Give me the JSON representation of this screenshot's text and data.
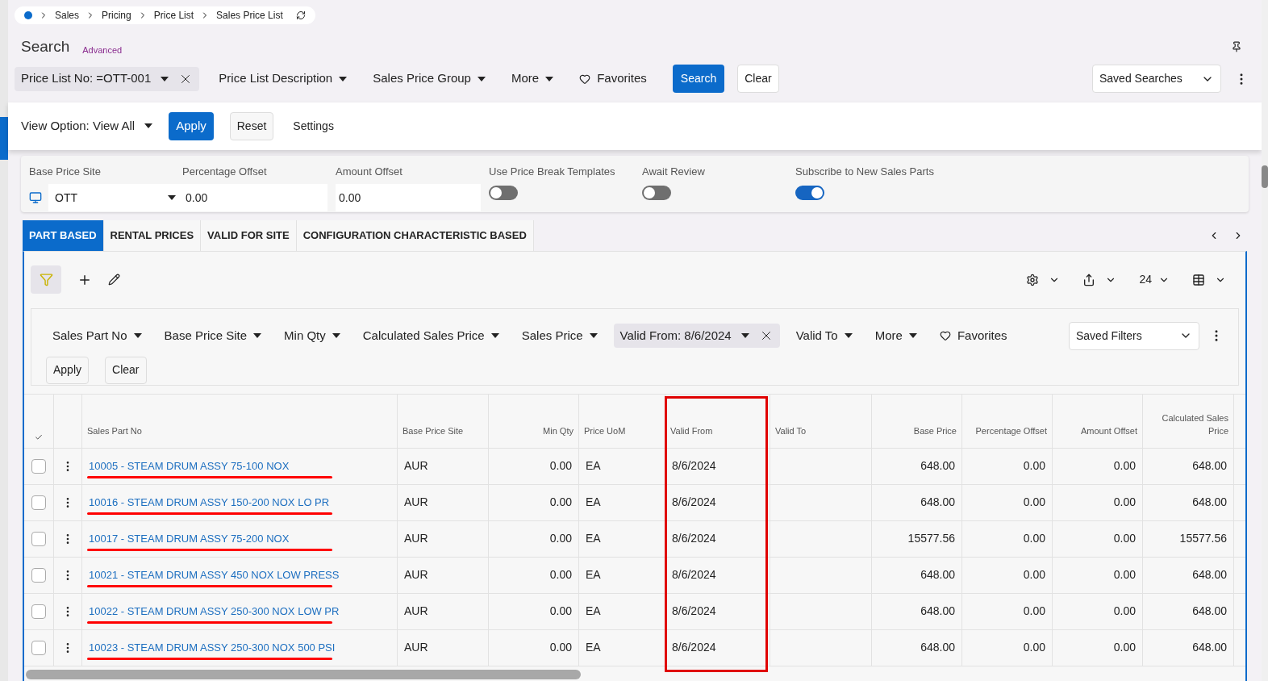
{
  "breadcrumb": [
    "Sales",
    "Pricing",
    "Price List",
    "Sales Price List"
  ],
  "search": {
    "title": "Search",
    "advanced": "Advanced",
    "filters": [
      {
        "label": "Price List No: =OTT-001",
        "kind": "active"
      },
      {
        "label": "Price List Description",
        "kind": "dropdown"
      },
      {
        "label": "Sales Price Group",
        "kind": "dropdown"
      },
      {
        "label": "More",
        "kind": "dropdown"
      },
      {
        "label": "Favorites",
        "kind": "favorites"
      }
    ],
    "search_button": "Search",
    "clear_button": "Clear",
    "saved_searches": "Saved Searches"
  },
  "view_bar": {
    "view_option": "View Option: View All",
    "apply": "Apply",
    "reset": "Reset",
    "settings": "Settings"
  },
  "header_fields": {
    "base_price_site": {
      "label": "Base Price Site",
      "value": "OTT"
    },
    "percentage_offset": {
      "label": "Percentage Offset",
      "value": "0.00"
    },
    "amount_offset": {
      "label": "Amount Offset",
      "value": "0.00"
    },
    "toggles": [
      {
        "label": "Use Price Break Templates",
        "on": false
      },
      {
        "label": "Await Review",
        "on": false
      },
      {
        "label": "Subscribe to New Sales Parts",
        "on": true
      }
    ]
  },
  "tabs": [
    {
      "label": "PART BASED",
      "selected": true
    },
    {
      "label": "RENTAL PRICES",
      "selected": false
    },
    {
      "label": "VALID FOR SITE",
      "selected": false
    },
    {
      "label": "CONFIGURATION CHARACTERISTIC BASED",
      "selected": false
    }
  ],
  "toolbar": {
    "page_size": "24"
  },
  "grid_filters": {
    "filters": [
      {
        "label": "Sales Part No",
        "kind": "dropdown"
      },
      {
        "label": "Base Price Site",
        "kind": "dropdown"
      },
      {
        "label": "Min Qty",
        "kind": "dropdown"
      },
      {
        "label": "Calculated Sales Price",
        "kind": "dropdown"
      },
      {
        "label": "Sales Price",
        "kind": "dropdown"
      },
      {
        "label": "Valid From: 8/6/2024",
        "kind": "active"
      },
      {
        "label": "Valid To",
        "kind": "dropdown"
      },
      {
        "label": "More",
        "kind": "dropdown"
      },
      {
        "label": "Favorites",
        "kind": "favorites"
      }
    ],
    "apply": "Apply",
    "clear": "Clear",
    "saved_filters": "Saved Filters"
  },
  "table": {
    "columns": [
      "Sales Part No",
      "Base Price Site",
      "Min Qty",
      "Price UoM",
      "Valid From",
      "Valid To",
      "Base Price",
      "Percentage Offset",
      "Amount Offset",
      "Calculated Sales Price"
    ],
    "rows": [
      {
        "selected": false,
        "cells": [
          "10005 - STEAM DRUM ASSY 75-100 NOX",
          "AUR",
          "0.00",
          "EA",
          "8/6/2024",
          "",
          "648.00",
          "0.00",
          "0.00",
          "648.00"
        ]
      },
      {
        "selected": false,
        "cells": [
          "10016 - STEAM DRUM ASSY 150-200 NOX LO PR",
          "AUR",
          "0.00",
          "EA",
          "8/6/2024",
          "",
          "648.00",
          "0.00",
          "0.00",
          "648.00"
        ]
      },
      {
        "selected": false,
        "cells": [
          "10017 - STEAM DRUM ASSY 75-200 NOX",
          "AUR",
          "0.00",
          "EA",
          "8/6/2024",
          "",
          "15577.56",
          "0.00",
          "0.00",
          "15577.56"
        ]
      },
      {
        "selected": false,
        "cells": [
          "10021 - STEAM DRUM ASSY 450 NOX LOW PRESS",
          "AUR",
          "0.00",
          "EA",
          "8/6/2024",
          "",
          "648.00",
          "0.00",
          "0.00",
          "648.00"
        ]
      },
      {
        "selected": false,
        "cells": [
          "10022 - STEAM DRUM ASSY 250-300 NOX LOW PR",
          "AUR",
          "0.00",
          "EA",
          "8/6/2024",
          "",
          "648.00",
          "0.00",
          "0.00",
          "648.00"
        ]
      },
      {
        "selected": false,
        "cells": [
          "10023 - STEAM DRUM ASSY 250-300 NOX 500 PSI",
          "AUR",
          "0.00",
          "EA",
          "8/6/2024",
          "",
          "648.00",
          "0.00",
          "0.00",
          "648.00"
        ]
      }
    ]
  }
}
